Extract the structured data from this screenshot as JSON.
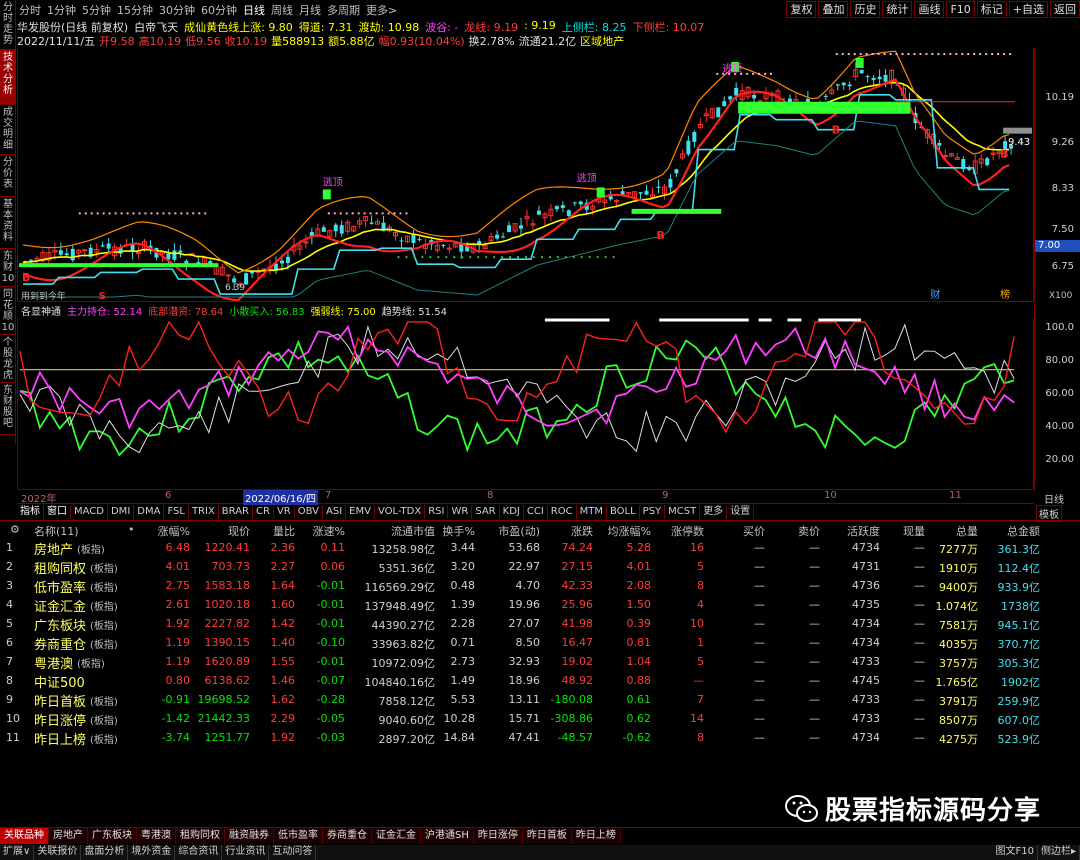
{
  "left_tabs": [
    "分时走势",
    "技术分析",
    "成交明细",
    "分价表",
    "基本资料",
    "东财10",
    "同花顺10",
    "个股龙虎",
    "东财股吧"
  ],
  "periods": [
    "分时",
    "1分钟",
    "5分钟",
    "15分钟",
    "30分钟",
    "60分钟",
    "日线",
    "周线",
    "月线",
    "多周期",
    "更多>"
  ],
  "active_period": "日线",
  "top_buttons": [
    "复权",
    "叠加",
    "历史",
    "统计",
    "画线",
    "F10",
    "标记",
    "+自选",
    "返回"
  ],
  "info1": {
    "stock": "华发股份(日线 前复权)",
    "indicator": "白帝飞天",
    "line1_label": "成仙黄色线上涨:",
    "line1_val": "9.80",
    "deguan": "得道: 7.31",
    "boxun": "渡劫: 10.98",
    "bogu": "波谷: -",
    "longxian": "龙线: 9.19",
    "longval": ": 9.19",
    "upper": "上侧栏: 8.25",
    "lower": "下侧栏: 10.07"
  },
  "info2": {
    "date": "2022/11/11/五",
    "open": "开9.58",
    "high": "高10.19",
    "low": "低9.56",
    "close": "收10.19",
    "vol": "量588913",
    "amount": "额5.88亿",
    "change": "幅0.93(10.04%)",
    "turnover": "换2.78%",
    "float": "流通21.2亿",
    "sector": "区域地产"
  },
  "y_axis_main": [
    "10.19",
    "9.26",
    "8.33",
    "7.50",
    "6.75"
  ],
  "y_axis_badges": {
    "current": "9.43",
    "left_tag": "7.00",
    "mult": "X100"
  },
  "chart_labels": {
    "top1": "逃顶",
    "top2": "逃顶",
    "top3": "逃顶",
    "b1": "B",
    "b2": "B",
    "b3": "B",
    "b4": "B",
    "s1": "S",
    "bottom1": "6.39",
    "cai": "财",
    "bang": "榜",
    "yesterday": "用到到今年"
  },
  "sub_header": {
    "name": "各显神通",
    "main": "主力持仓: 52.14",
    "bottom": "底部潜资: 78.64",
    "retail": "小散买入: 56.83",
    "strong": "强弱线: 75.00",
    "trend": "趋势线: 51.54"
  },
  "y_axis_sub": [
    "100.0",
    "80.00",
    "60.00",
    "40.00",
    "20.00"
  ],
  "x_axis": [
    {
      "label": "2022年"
    },
    {
      "label": "6"
    },
    {
      "label": "2022/06/16/四"
    },
    {
      "label": "7"
    },
    {
      "label": "8"
    },
    {
      "label": "9"
    },
    {
      "label": "10"
    },
    {
      "label": "11"
    }
  ],
  "x_axis_right": "日线",
  "indicator_tabs": [
    "指标",
    "窗口",
    "MACD",
    "DMI",
    "DMA",
    "FSL",
    "TRIX",
    "BRAR",
    "CR",
    "VR",
    "OBV",
    "ASI",
    "EMV",
    "VOL-TDX",
    "RSI",
    "WR",
    "SAR",
    "KDJ",
    "CCI",
    "ROC",
    "MTM",
    "BOLL",
    "PSY",
    "MCST",
    "更多",
    "设置"
  ],
  "indicator_right": "模板",
  "table": {
    "headers": [
      "",
      "名称(11)",
      "•",
      "涨幅%",
      "现价",
      "量比",
      "涨速%",
      "流通市值",
      "换手%",
      "市盈(动)",
      "涨跌",
      "均涨幅%",
      "涨停数",
      "买价",
      "卖价",
      "活跃度",
      "现量",
      "总量",
      "总金额"
    ],
    "rows": [
      {
        "idx": "1",
        "name": "房地产",
        "tag": "(板指)",
        "chg": "6.48",
        "price": "1220.41",
        "lb": "2.36",
        "spd": "0.11",
        "mcap": "13258.98亿",
        "turn": "3.44",
        "pe": "53.68",
        "diff": "74.24",
        "avg": "5.28",
        "zt": "16",
        "buy": "—",
        "sell": "—",
        "act": "4734",
        "now": "—",
        "vol": "7277万",
        "amt": "361.3亿"
      },
      {
        "idx": "2",
        "name": "租购同权",
        "tag": "(板指)",
        "chg": "4.01",
        "price": "703.73",
        "lb": "2.27",
        "spd": "0.06",
        "mcap": "5351.36亿",
        "turn": "3.20",
        "pe": "22.97",
        "diff": "27.15",
        "avg": "4.01",
        "zt": "5",
        "buy": "—",
        "sell": "—",
        "act": "4731",
        "now": "—",
        "vol": "1910万",
        "amt": "112.4亿"
      },
      {
        "idx": "3",
        "name": "低市盈率",
        "tag": "(板指)",
        "chg": "2.75",
        "price": "1583.18",
        "lb": "1.64",
        "spd": "-0.01",
        "mcap": "116569.29亿",
        "turn": "0.48",
        "pe": "4.70",
        "diff": "42.33",
        "avg": "2.08",
        "zt": "8",
        "buy": "—",
        "sell": "—",
        "act": "4736",
        "now": "—",
        "vol": "9400万",
        "amt": "933.9亿"
      },
      {
        "idx": "4",
        "name": "证金汇金",
        "tag": "(板指)",
        "chg": "2.61",
        "price": "1020.18",
        "lb": "1.60",
        "spd": "-0.01",
        "mcap": "137948.49亿",
        "turn": "1.39",
        "pe": "19.96",
        "diff": "25.96",
        "avg": "1.50",
        "zt": "4",
        "buy": "—",
        "sell": "—",
        "act": "4735",
        "now": "—",
        "vol": "1.074亿",
        "amt": "1738亿"
      },
      {
        "idx": "5",
        "name": "广东板块",
        "tag": "(板指)",
        "chg": "1.92",
        "price": "2227.82",
        "lb": "1.42",
        "spd": "-0.01",
        "mcap": "44390.27亿",
        "turn": "2.28",
        "pe": "27.07",
        "diff": "41.98",
        "avg": "0.39",
        "zt": "10",
        "buy": "—",
        "sell": "—",
        "act": "4734",
        "now": "—",
        "vol": "7581万",
        "amt": "945.1亿"
      },
      {
        "idx": "6",
        "name": "券商重仓",
        "tag": "(板指)",
        "chg": "1.19",
        "price": "1390.15",
        "lb": "1.40",
        "spd": "-0.10",
        "mcap": "33963.82亿",
        "turn": "0.71",
        "pe": "8.50",
        "diff": "16.47",
        "avg": "0.81",
        "zt": "1",
        "buy": "—",
        "sell": "—",
        "act": "4734",
        "now": "—",
        "vol": "4035万",
        "amt": "370.7亿"
      },
      {
        "idx": "7",
        "name": "粤港澳",
        "tag": "(板指)",
        "chg": "1.19",
        "price": "1620.89",
        "lb": "1.55",
        "spd": "-0.01",
        "mcap": "10972.09亿",
        "turn": "2.73",
        "pe": "32.93",
        "diff": "19.02",
        "avg": "1.04",
        "zt": "5",
        "buy": "—",
        "sell": "—",
        "act": "4733",
        "now": "—",
        "vol": "3757万",
        "amt": "305.3亿"
      },
      {
        "idx": "8",
        "name": "中证500",
        "tag": "",
        "chg": "0.80",
        "price": "6138.62",
        "lb": "1.46",
        "spd": "-0.07",
        "mcap": "104840.16亿",
        "turn": "1.49",
        "pe": "18.96",
        "diff": "48.92",
        "avg": "0.88",
        "zt": "—",
        "buy": "—",
        "sell": "—",
        "act": "4745",
        "now": "—",
        "vol": "1.765亿",
        "amt": "1902亿"
      },
      {
        "idx": "9",
        "name": "昨日首板",
        "tag": "(板指)",
        "chg": "-0.91",
        "price": "19698.52",
        "lb": "1.62",
        "spd": "-0.28",
        "mcap": "7858.12亿",
        "turn": "5.53",
        "pe": "13.11",
        "diff": "-180.08",
        "avg": "0.61",
        "zt": "7",
        "buy": "—",
        "sell": "—",
        "act": "4733",
        "now": "—",
        "vol": "3791万",
        "amt": "259.9亿"
      },
      {
        "idx": "10",
        "name": "昨日涨停",
        "tag": "(板指)",
        "chg": "-1.42",
        "price": "21442.33",
        "lb": "2.29",
        "spd": "-0.05",
        "mcap": "9040.60亿",
        "turn": "10.28",
        "pe": "15.71",
        "diff": "-308.86",
        "avg": "0.62",
        "zt": "14",
        "buy": "—",
        "sell": "—",
        "act": "4733",
        "now": "—",
        "vol": "8507万",
        "amt": "607.0亿"
      },
      {
        "idx": "11",
        "name": "昨日上榜",
        "tag": "(板指)",
        "chg": "-3.74",
        "price": "1251.77",
        "lb": "1.92",
        "spd": "-0.03",
        "mcap": "2897.20亿",
        "turn": "14.84",
        "pe": "47.41",
        "diff": "-48.57",
        "avg": "-0.62",
        "zt": "8",
        "buy": "—",
        "sell": "—",
        "act": "4734",
        "now": "—",
        "vol": "4275万",
        "amt": "523.9亿"
      }
    ]
  },
  "bottom_tabs": [
    "关联品种",
    "房地产",
    "广东板块",
    "粤港澳",
    "租购同权",
    "融资融券",
    "低市盈率",
    "券商重仓",
    "证金汇金",
    "沪港通SH",
    "昨日涨停",
    "昨日首板",
    "昨日上榜"
  ],
  "status_items": [
    "扩展∨",
    "关联报价",
    "盘面分析",
    "境外资金",
    "综合资讯",
    "行业资讯",
    "互动问答"
  ],
  "status_right": [
    "图文F10",
    "侧边栏▸"
  ],
  "watermark": "股票指标源码分享",
  "colors": {
    "up": "#ff3c3c",
    "down": "#00e600",
    "accent": "#ffff00",
    "border": "#7a0000"
  }
}
